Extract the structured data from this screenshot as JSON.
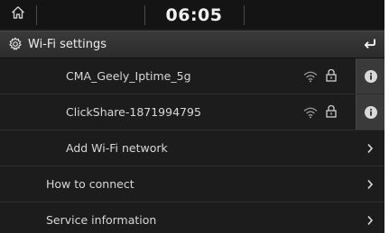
{
  "status": {
    "time": "06:05"
  },
  "header": {
    "title": "Wi-Fi settings"
  },
  "networks": [
    {
      "ssid": "CMA_Geely_Iptime_5g"
    },
    {
      "ssid": "ClickShare-1871994795"
    }
  ],
  "menu": {
    "add_network": "Add Wi-Fi network",
    "how_to_connect": "How to connect",
    "service_information": "Service information"
  },
  "icons": {
    "home": "home-icon",
    "settings": "gear-icon",
    "back": "back-arrow-icon",
    "wifi": "wifi-signal-icon",
    "lock": "lock-icon",
    "info": "info-icon",
    "chevron": "chevron-right-icon"
  }
}
